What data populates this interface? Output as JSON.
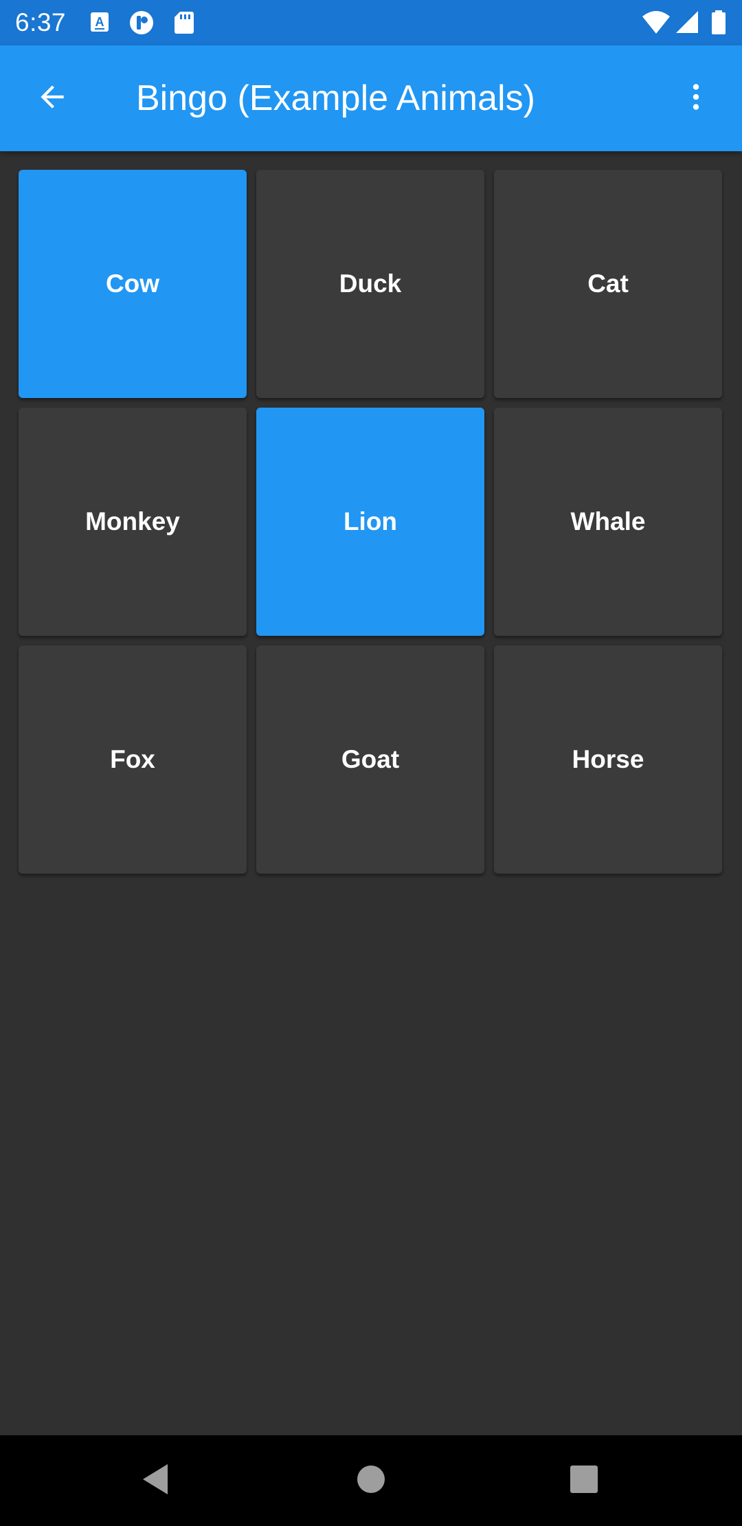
{
  "status_bar": {
    "time": "6:37",
    "icons": [
      "accessibility-a-icon",
      "app-notification-icon",
      "sd-card-icon",
      "wifi-icon",
      "cell-signal-icon",
      "battery-icon"
    ]
  },
  "app_bar": {
    "title": "Bingo (Example Animals)",
    "back_icon": "arrow-back-icon",
    "menu_icon": "more-vert-icon"
  },
  "board": {
    "tiles": [
      {
        "label": "Cow",
        "selected": true
      },
      {
        "label": "Duck",
        "selected": false
      },
      {
        "label": "Cat",
        "selected": false
      },
      {
        "label": "Monkey",
        "selected": false
      },
      {
        "label": "Lion",
        "selected": true
      },
      {
        "label": "Whale",
        "selected": false
      },
      {
        "label": "Fox",
        "selected": false
      },
      {
        "label": "Goat",
        "selected": false
      },
      {
        "label": "Horse",
        "selected": false
      }
    ]
  },
  "nav_bar": {
    "icons": [
      "back-triangle-icon",
      "home-circle-icon",
      "recents-square-icon"
    ]
  },
  "colors": {
    "accent": "#2196F3",
    "status_bar": "#1976D2",
    "background": "#303030",
    "tile": "#3A3B3A"
  }
}
